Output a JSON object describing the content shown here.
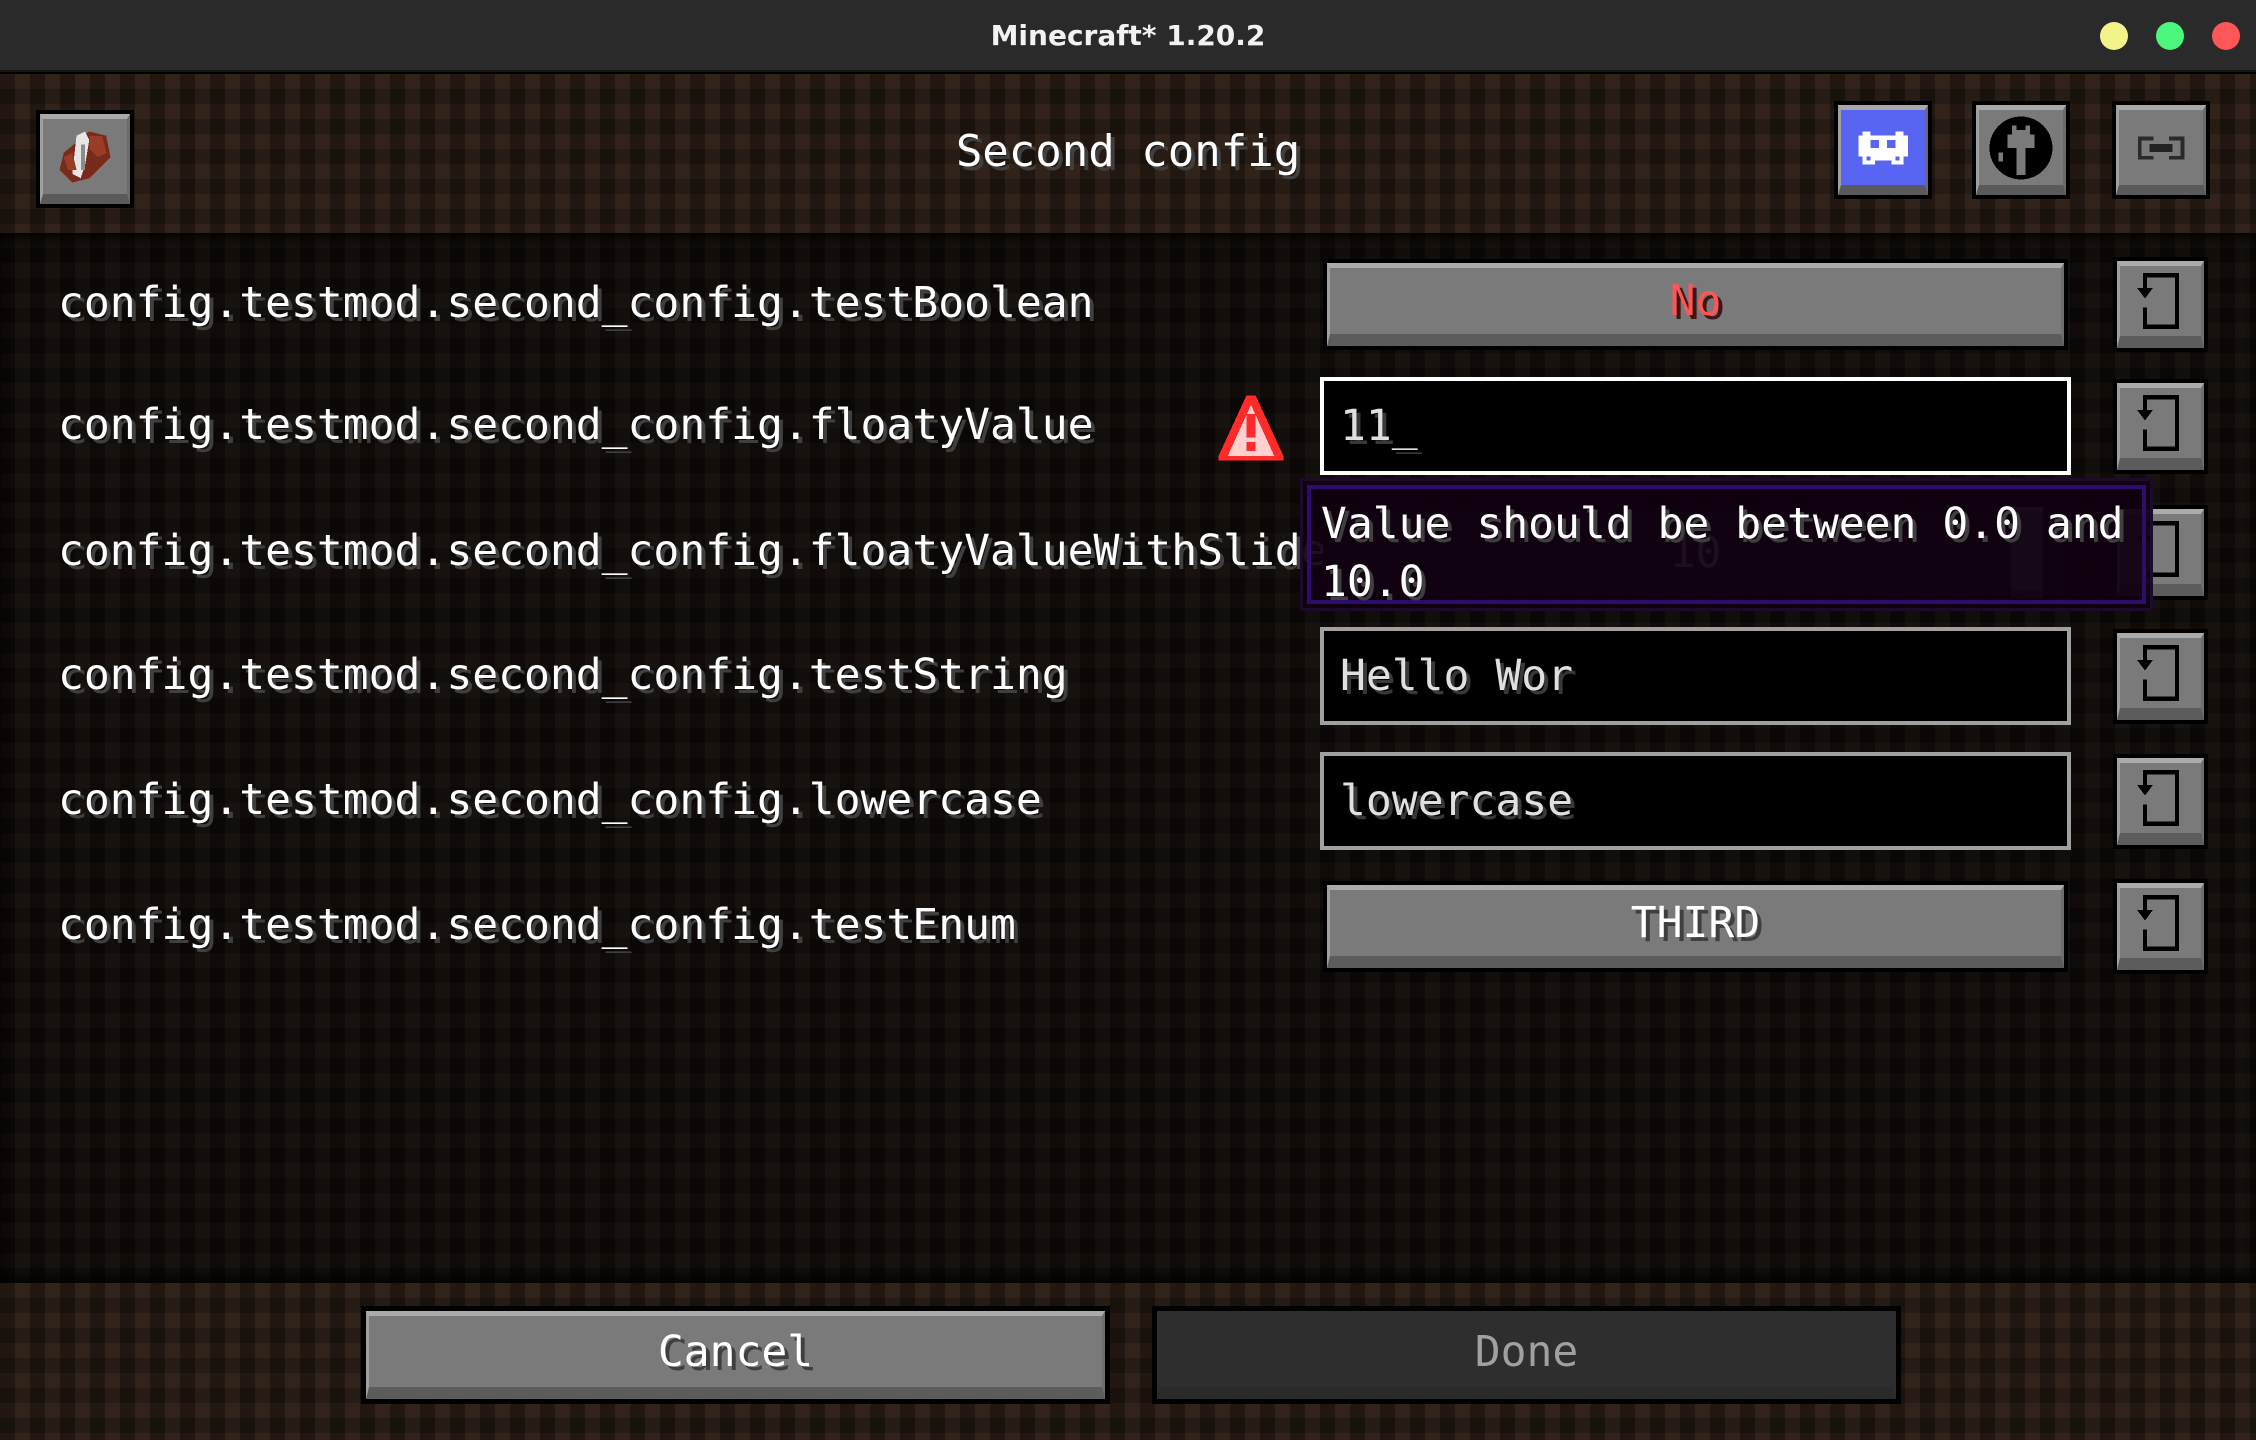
{
  "window": {
    "title": "Minecraft* 1.20.2",
    "controls": [
      {
        "name": "minimize",
        "color": "#f3f38a"
      },
      {
        "name": "maximize",
        "color": "#4cf57c"
      },
      {
        "name": "close",
        "color": "#ff5757"
      }
    ]
  },
  "header": {
    "title": "Second config",
    "left_icon": "book-icon",
    "right_icons": [
      "discord-icon",
      "github-icon",
      "link-icon"
    ],
    "discord_color": "#5865f2"
  },
  "entries": [
    {
      "label": "config.testmod.second_config.testBoolean",
      "type": "toggle",
      "value": "No",
      "value_color": "#ff5555"
    },
    {
      "label": "config.testmod.second_config.floatyValue",
      "type": "text",
      "value": "11_",
      "focused": true,
      "error": true
    },
    {
      "label": "config.testmod.second_config.floatyValueWithSlider",
      "type": "slider",
      "value": "10",
      "slider_fraction": 0.97
    },
    {
      "label": "config.testmod.second_config.testString",
      "type": "text",
      "value": "Hello Wor"
    },
    {
      "label": "config.testmod.second_config.lowercase",
      "type": "text",
      "value": "lowercase"
    },
    {
      "label": "config.testmod.second_config.testEnum",
      "type": "cycle",
      "value": "THIRD"
    }
  ],
  "tooltip": {
    "line1": "Value should be between 0.0 and",
    "line2": "10.0"
  },
  "footer": {
    "cancel_label": "Cancel",
    "done_label": "Done",
    "done_enabled": false
  }
}
